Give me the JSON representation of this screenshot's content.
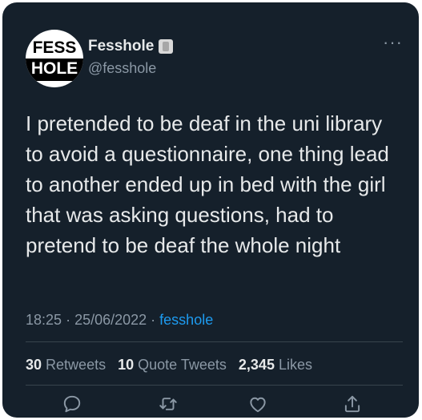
{
  "user": {
    "avatar_top": "FESS",
    "avatar_bottom": "HOLE",
    "name": "Fesshole",
    "handle": "@fesshole"
  },
  "tweet": {
    "text": "I pretended to be deaf in the uni library to avoid a questionnaire, one thing lead to another ended up in bed with the girl that was asking questions, had to pretend to be deaf the whole night",
    "time": "18:25",
    "date": "25/06/2022",
    "source": "fesshole"
  },
  "stats": {
    "retweets_count": "30",
    "retweets_label": "Retweets",
    "quotes_count": "10",
    "quotes_label": "Quote Tweets",
    "likes_count": "2,345",
    "likes_label": "Likes"
  },
  "icons": [
    "more-icon",
    "reply-icon",
    "retweet-icon",
    "like-icon",
    "share-icon"
  ],
  "colors": {
    "background": "#15202b",
    "text": "#e7e9ea",
    "muted": "#8b98a5",
    "link": "#1d9bf0"
  }
}
